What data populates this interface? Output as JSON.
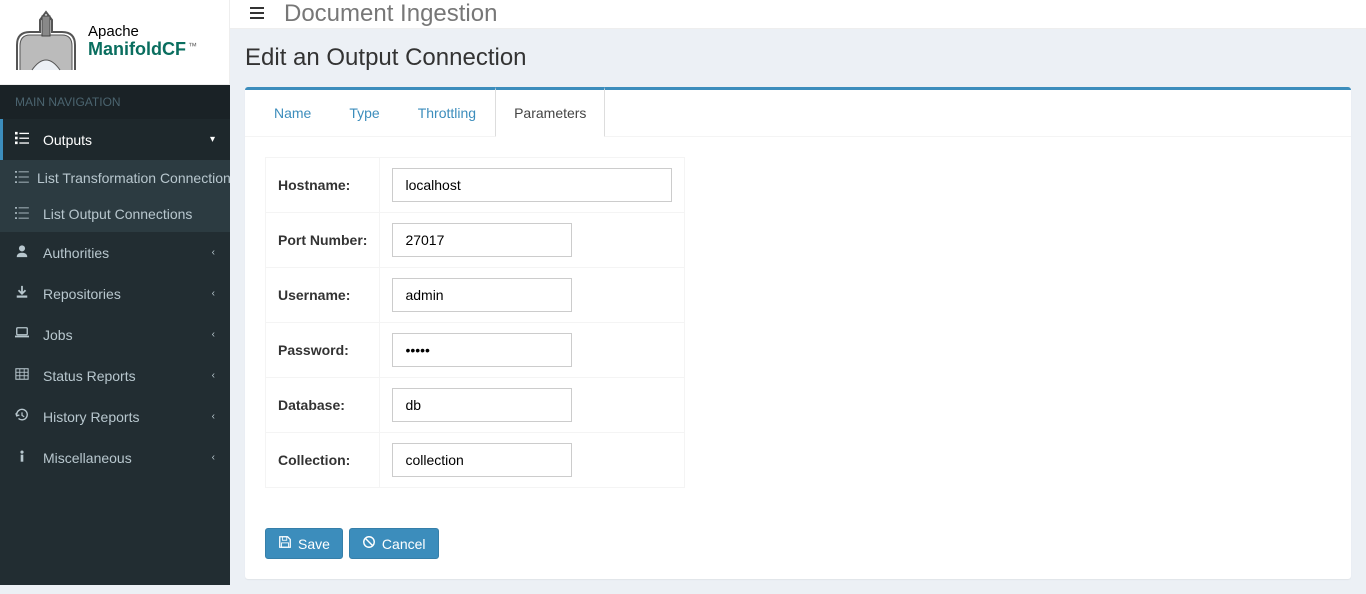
{
  "logo": {
    "line1": "Apache",
    "line2": "ManifoldCF",
    "tm": "™"
  },
  "topbar": {
    "title": "Document Ingestion"
  },
  "sidebar": {
    "nav_header": "MAIN NAVIGATION",
    "items": {
      "outputs": "Outputs",
      "outputs_sub": {
        "list_transformation": "List Transformation Connections",
        "list_output": "List Output Connections"
      },
      "authorities": "Authorities",
      "repositories": "Repositories",
      "jobs": "Jobs",
      "status_reports": "Status Reports",
      "history_reports": "History Reports",
      "miscellaneous": "Miscellaneous"
    }
  },
  "page": {
    "title": "Edit an Output Connection",
    "tabs": {
      "name": "Name",
      "type": "Type",
      "throttling": "Throttling",
      "parameters": "Parameters"
    },
    "form": {
      "hostname_label": "Hostname:",
      "hostname_value": "localhost",
      "port_label": "Port Number:",
      "port_value": "27017",
      "username_label": "Username:",
      "username_value": "admin",
      "password_label": "Password:",
      "password_value": "admin",
      "database_label": "Database:",
      "database_value": "db",
      "collection_label": "Collection:",
      "collection_value": "collection"
    },
    "buttons": {
      "save": "Save",
      "cancel": "Cancel"
    }
  }
}
